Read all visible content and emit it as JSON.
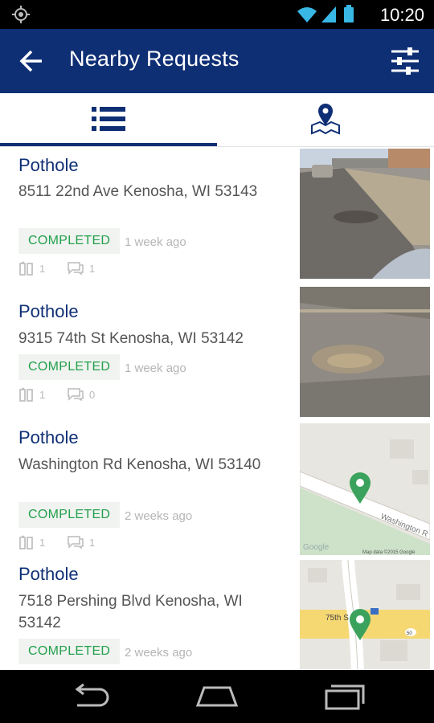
{
  "status_bar": {
    "time": "10:20"
  },
  "app_bar": {
    "title": "Nearby Requests"
  },
  "tabs": [
    {
      "name": "list",
      "selected": true
    },
    {
      "name": "map",
      "selected": false
    }
  ],
  "requests": [
    {
      "type": "Pothole",
      "address": "8511 22nd Ave Kenosha, WI 53143",
      "status": "COMPLETED",
      "time": "1 week ago",
      "votes": "1",
      "comments": "1"
    },
    {
      "type": "Pothole",
      "address": "9315 74th St Kenosha, WI 53142",
      "status": "COMPLETED",
      "time": "1 week ago",
      "votes": "1",
      "comments": "0"
    },
    {
      "type": "Pothole",
      "address": "Washington Rd Kenosha, WI 53140",
      "status": "COMPLETED",
      "time": "2 weeks ago",
      "votes": "1",
      "comments": "1",
      "map_label": "Washington R",
      "map_credit": "Map data ©2015 Google",
      "map_logo": "Google"
    },
    {
      "type": "Pothole",
      "address": "7518 Pershing Blvd Kenosha, WI 53142",
      "status": "COMPLETED",
      "time": "2 weeks ago",
      "map_label": "75th S",
      "map_shield": "50"
    }
  ],
  "colors": {
    "primary": "#0f2f75",
    "status_green": "#22a04b",
    "status_bg": "#f1f3f1",
    "pin": "#3aa25c"
  }
}
